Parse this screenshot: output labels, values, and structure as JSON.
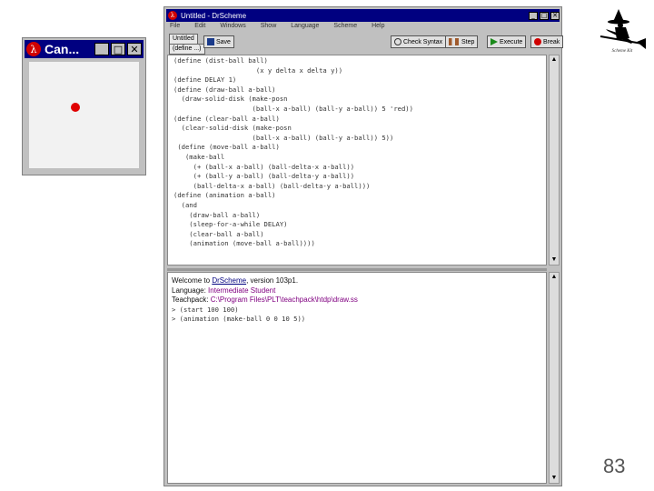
{
  "canvas_window": {
    "title": "Can..."
  },
  "drscheme": {
    "title": "Untitled - DrScheme",
    "menu": [
      "File",
      "Edit",
      "Windows",
      "Show",
      "Language",
      "Scheme",
      "Help"
    ],
    "tabs": {
      "top": "Untitled",
      "bottom": "(define ...)"
    },
    "toolbar": {
      "save": "Save",
      "check_syntax": "Check Syntax",
      "step": "Step",
      "execute": "Execute",
      "break": "Break"
    },
    "code_lines": [
      "(define (dist-ball ball)",
      "                     (x y delta x delta y))",
      "(define DELAY 1)",
      "(define (draw-ball a-ball)",
      "  (draw-solid-disk (make-posn",
      "                    (ball-x a-ball) (ball-y a-ball)) 5 'red))",
      "(define (clear-ball a-ball)",
      "  (clear-solid-disk (make-posn",
      "                    (ball-x a-ball) (ball-y a-ball)) 5))",
      " (define (move-ball a-ball)",
      "   (make-ball",
      "     (+ (ball-x a-ball) (ball-delta-x a-ball))",
      "     (+ (ball-y a-ball) (ball-delta-y a-ball))",
      "     (ball-delta-x a-ball) (ball-delta-y a-ball)))",
      "(define (animation a-ball)",
      "  (and",
      "    (draw-ball a-ball)",
      "    (sleep-for-a-while DELAY)",
      "    (clear-ball a-ball)",
      "    (animation (move-ball a-ball))))"
    ],
    "repl": {
      "welcome_prefix": "Welcome to ",
      "welcome_link": "DrScheme",
      "welcome_suffix": ", version 103p1.",
      "language_prefix": "Language: ",
      "language_value": "Intermediate Student",
      "teachpack_prefix": "Teachpack: ",
      "teachpack_value": "C:\\Program Files\\PLT\\teachpack\\htdp\\draw.ss",
      "input1": "> (start 100 100)",
      "input2": "> (animation (make-ball 0 0 10 5))"
    }
  },
  "logo_caption": "Scheme Kit",
  "page_number": "83",
  "colors": {
    "titlebar": "#000080",
    "ball": "#e00000",
    "language": "#800080"
  }
}
